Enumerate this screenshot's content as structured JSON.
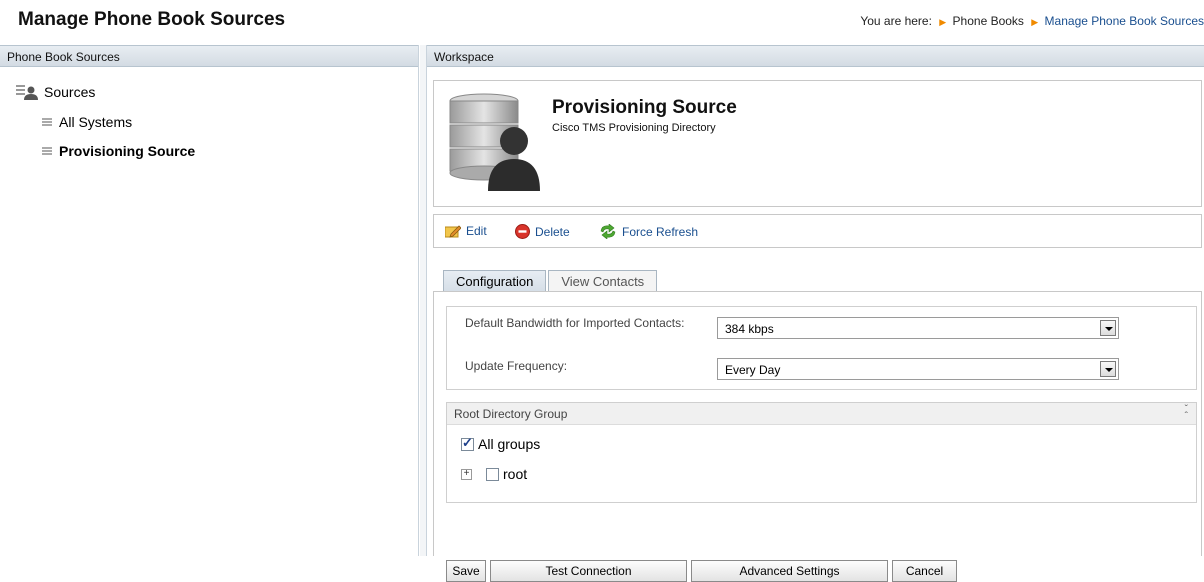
{
  "header": {
    "title": "Manage Phone Book Sources",
    "breadcrumb_prefix": "You are here:",
    "breadcrumb": [
      "Phone Books",
      "Manage Phone Book Sources"
    ]
  },
  "left_panel": {
    "title": "Phone Book Sources",
    "tree": {
      "root_label": "Sources",
      "items": [
        {
          "label": "All Systems",
          "selected": false
        },
        {
          "label": "Provisioning Source",
          "selected": true
        }
      ]
    }
  },
  "workspace": {
    "title": "Workspace",
    "source": {
      "name": "Provisioning Source",
      "type": "Cisco TMS Provisioning Directory"
    },
    "actions": {
      "edit": "Edit",
      "delete": "Delete",
      "force_refresh": "Force Refresh"
    },
    "tabs": [
      {
        "label": "Configuration",
        "active": true
      },
      {
        "label": "View Contacts",
        "active": false
      }
    ],
    "form": {
      "bandwidth_label": "Default Bandwidth for Imported Contacts:",
      "bandwidth_value": "384 kbps",
      "frequency_label": "Update Frequency:",
      "frequency_value": "Every Day"
    },
    "group": {
      "title": "Root Directory Group",
      "all_groups_label": "All groups",
      "all_groups_checked": true,
      "root_label": "root",
      "root_checked": false
    },
    "buttons": {
      "save": "Save",
      "test_connection": "Test Connection",
      "advanced_settings": "Advanced Settings",
      "cancel": "Cancel"
    }
  },
  "colors": {
    "link": "#1a4f8f",
    "breadcrumb_arrow": "#f08a00",
    "panel_header": "#d3dbe3"
  }
}
